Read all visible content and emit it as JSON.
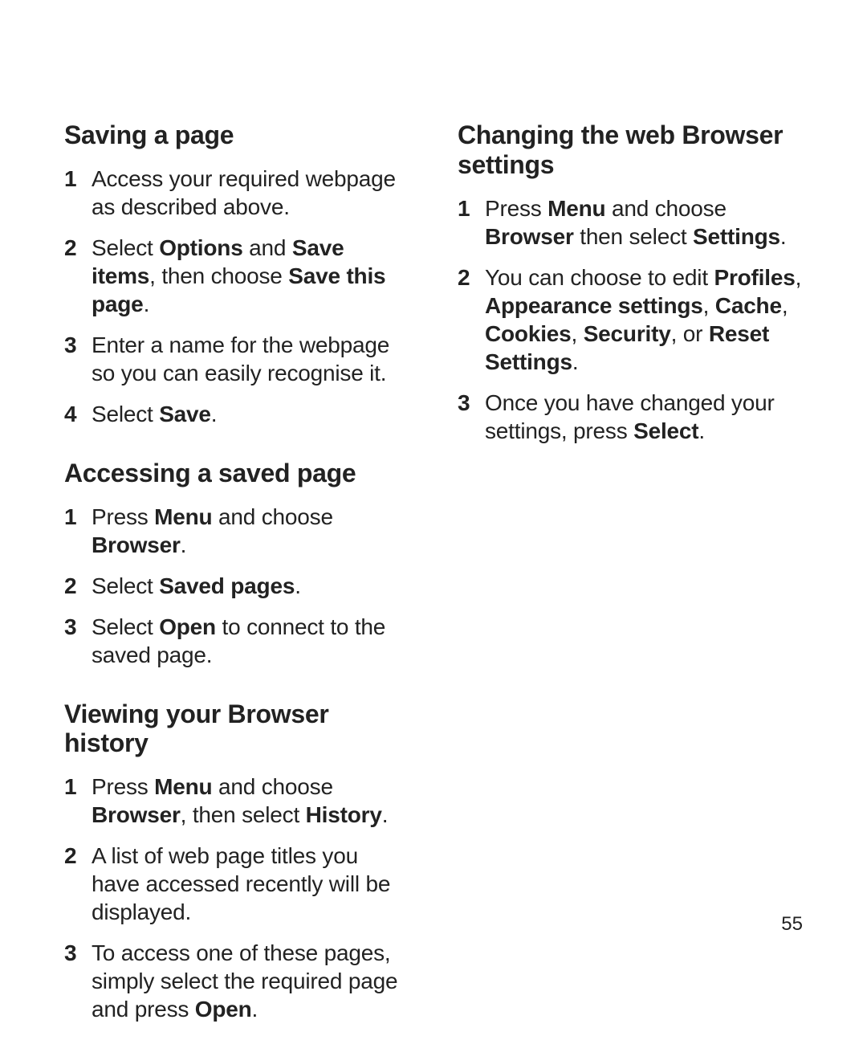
{
  "page_number": "55",
  "left": {
    "section1": {
      "heading": "Saving a page",
      "steps": [
        [
          {
            "t": "Access your required webpage as described above."
          }
        ],
        [
          {
            "t": "Select "
          },
          {
            "b": true,
            "t": "Options"
          },
          {
            "t": " and "
          },
          {
            "b": true,
            "t": "Save items"
          },
          {
            "t": ", then choose "
          },
          {
            "b": true,
            "t": "Save this page"
          },
          {
            "t": "."
          }
        ],
        [
          {
            "t": "Enter a name for the webpage so you can easily recognise it."
          }
        ],
        [
          {
            "t": "Select "
          },
          {
            "b": true,
            "t": "Save"
          },
          {
            "t": "."
          }
        ]
      ]
    },
    "section2": {
      "heading": "Accessing a saved page",
      "steps": [
        [
          {
            "t": "Press "
          },
          {
            "b": true,
            "t": "Menu"
          },
          {
            "t": " and choose "
          },
          {
            "b": true,
            "t": "Browser"
          },
          {
            "t": "."
          }
        ],
        [
          {
            "t": "Select "
          },
          {
            "b": true,
            "t": "Saved pages"
          },
          {
            "t": "."
          }
        ],
        [
          {
            "t": "Select "
          },
          {
            "b": true,
            "t": "Open"
          },
          {
            "t": " to connect to the saved page."
          }
        ]
      ]
    },
    "section3": {
      "heading": "Viewing your Browser history",
      "steps": [
        [
          {
            "t": "Press "
          },
          {
            "b": true,
            "t": "Menu"
          },
          {
            "t": " and choose "
          },
          {
            "b": true,
            "t": "Browser"
          },
          {
            "t": ", then select "
          },
          {
            "b": true,
            "t": "History"
          },
          {
            "t": "."
          }
        ],
        [
          {
            "t": "A list of web page titles you have accessed recently will be displayed."
          }
        ],
        [
          {
            "t": "To access one of these pages, simply select the required page and press "
          },
          {
            "b": true,
            "t": "Open"
          },
          {
            "t": "."
          }
        ]
      ]
    }
  },
  "right": {
    "section1": {
      "heading": "Changing the web Browser settings",
      "steps": [
        [
          {
            "t": "Press "
          },
          {
            "b": true,
            "t": "Menu"
          },
          {
            "t": " and choose "
          },
          {
            "b": true,
            "t": "Browser"
          },
          {
            "t": " then select "
          },
          {
            "b": true,
            "t": "Settings"
          },
          {
            "t": "."
          }
        ],
        [
          {
            "t": "You can choose to edit "
          },
          {
            "b": true,
            "t": "Profiles"
          },
          {
            "t": ", "
          },
          {
            "b": true,
            "t": "Appearance settings"
          },
          {
            "t": ", "
          },
          {
            "b": true,
            "t": "Cache"
          },
          {
            "t": ", "
          },
          {
            "b": true,
            "t": "Cookies"
          },
          {
            "t": ", "
          },
          {
            "b": true,
            "t": "Security"
          },
          {
            "t": ", or "
          },
          {
            "b": true,
            "t": "Reset Settings"
          },
          {
            "t": "."
          }
        ],
        [
          {
            "t": "Once you have changed your settings, press "
          },
          {
            "b": true,
            "t": "Select"
          },
          {
            "t": "."
          }
        ]
      ]
    }
  }
}
